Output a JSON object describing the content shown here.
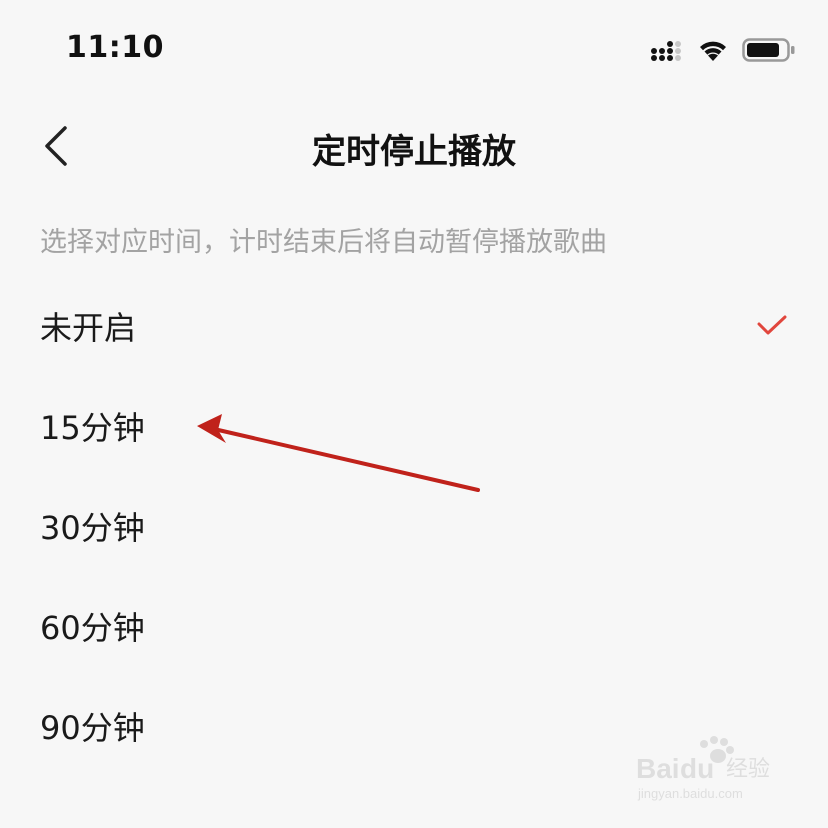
{
  "status_bar": {
    "time": "11:10",
    "icons": [
      "cellular-signal-icon",
      "wifi-icon",
      "battery-icon"
    ]
  },
  "header": {
    "back_icon": "chevron-left-icon",
    "title": "定时停止播放"
  },
  "description": "选择对应时间，计时结束后将自动暂停播放歌曲",
  "options": [
    {
      "label": "未开启",
      "selected": true
    },
    {
      "label": "15分钟",
      "selected": false
    },
    {
      "label": "30分钟",
      "selected": false
    },
    {
      "label": "60分钟",
      "selected": false
    },
    {
      "label": "90分钟",
      "selected": false
    }
  ],
  "colors": {
    "accent": "#e1463d",
    "annotation": "#c0221b",
    "description_text": "#a3a3a3",
    "background": "#f7f7f7"
  },
  "watermark": {
    "brand": "Baidu经验",
    "url": "jingyan.baidu.com"
  }
}
